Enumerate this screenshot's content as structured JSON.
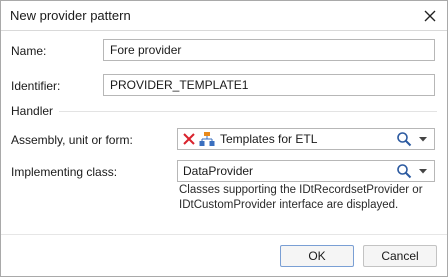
{
  "dialog": {
    "title": "New provider pattern"
  },
  "fields": {
    "name_label": "Name:",
    "name_value": "Fore provider",
    "identifier_label": "Identifier:",
    "identifier_value": "PROVIDER_TEMPLATE1"
  },
  "handler": {
    "group_label": "Handler",
    "assembly_label": "Assembly, unit or form:",
    "assembly_value": "Templates for ETL",
    "class_label": "Implementing class:",
    "class_value": "DataProvider",
    "hint": "Classes supporting the IDtRecordsetProvider or IDtCustomProvider interface are displayed."
  },
  "buttons": {
    "ok": "OK",
    "cancel": "Cancel"
  },
  "icons": {
    "close": "close-icon",
    "clear": "clear-x-icon",
    "tree": "hierarchy-icon",
    "search": "search-icon",
    "dropdown": "chevron-down-icon"
  },
  "colors": {
    "clear_red": "#d9232d",
    "tree_orange": "#e98a1b",
    "tree_blue": "#3a6fbf",
    "search_blue": "#2c5aa0"
  }
}
